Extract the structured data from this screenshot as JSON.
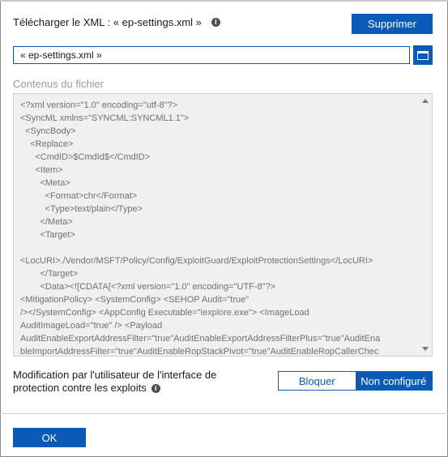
{
  "header": {
    "title": "Télécharger le XML : « ep-settings.xml »",
    "delete_label": "Supprimer"
  },
  "file": {
    "value": "« ep-settings.xml »"
  },
  "content": {
    "label": "Contenus du fichier",
    "lines": [
      "<?xml version=\"1.0\" encoding=\"utf-8\"?>",
      "<SyncML xmlns=\"SYNCML:SYNCML1.1\">",
      "  <SyncBody>",
      "    <Replace>",
      "      <CmdID>$CmdId$</CmdID>",
      "      <Item>",
      "        <Meta>",
      "          <Format>chr</Format>",
      "          <Type>text/plain</Type>",
      "        </Meta>",
      "        <Target>",
      "",
      "<LocURI>./Vendor/MSFT/Policy/Config/ExploitGuard/ExploitProtectionSettings</LocURI>",
      "        </Target>",
      "        <Data><![CDATA[<?xml version=\"1.0\" encoding=\"UTF-8\"?>",
      "<MitigationPolicy> <SystemConfig> <SEHOP Audit=\"true\"",
      "/></SystemConfig> <AppConfig Executable=\"iexplore.exe\"> <ImageLoad",
      "AuditImageLoad=\"true\" /> <Payload",
      "AuditEnableExportAddressFilter=\"true\"AuditEnableExportAddressFilterPlus=\"true\"AuditEna",
      "bleImportAddressFilter=\"true\"AuditEnableRopStackPivot=\"true\"AuditEnableRopCallerChec"
    ]
  },
  "protection": {
    "label_line1": "Modification par l'utilisateur de l'interface de",
    "label_line2": "protection contre les exploits",
    "options": [
      "Bloquer",
      "Non configuré"
    ],
    "selected": "Non configuré"
  },
  "footer": {
    "ok_label": "OK"
  },
  "icons": {
    "info": "info-icon",
    "browse": "folder-icon",
    "scroll_up": "chevron-up-icon",
    "scroll_down": "chevron-down-icon"
  },
  "colors": {
    "accent": "#0a5bb8",
    "textarea_bg": "#f0f0f0"
  }
}
